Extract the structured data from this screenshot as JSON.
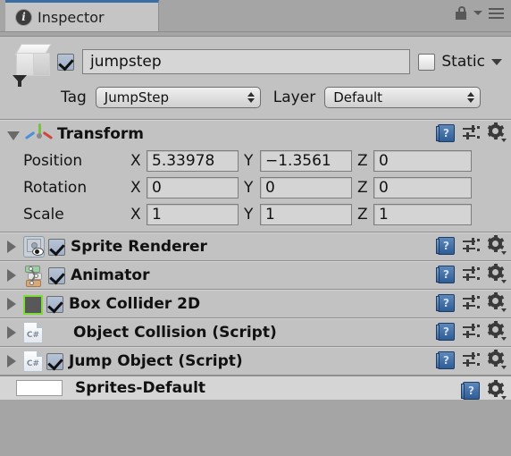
{
  "window": {
    "tab_label": "Inspector",
    "tab_icon": "info-icon",
    "lock_icon": "lock-open-icon",
    "menu_icon": "hamburger-menu-icon"
  },
  "gameobject": {
    "icon": "cube-prefab-icon",
    "enabled": true,
    "name": "jumpstep",
    "static_label": "Static",
    "static_checked": false,
    "tag_label": "Tag",
    "tag_value": "JumpStep",
    "layer_label": "Layer",
    "layer_value": "Default"
  },
  "transform": {
    "title": "Transform",
    "icon": "transform-axis-gizmo-icon",
    "expanded": true,
    "rows": [
      {
        "label": "Position",
        "x": "5.33978",
        "y": "−1.3561",
        "z": "0"
      },
      {
        "label": "Rotation",
        "x": "0",
        "y": "0",
        "z": "0"
      },
      {
        "label": "Scale",
        "x": "1",
        "y": "1",
        "z": "1"
      }
    ],
    "axis_labels": {
      "x": "X",
      "y": "Y",
      "z": "Z"
    }
  },
  "components": [
    {
      "title": "Sprite Renderer",
      "icon": "sprite-renderer-icon",
      "has_checkbox": true,
      "enabled": true,
      "expanded": false
    },
    {
      "title": "Animator",
      "icon": "animator-icon",
      "has_checkbox": true,
      "enabled": true,
      "expanded": false
    },
    {
      "title": "Box Collider 2D",
      "icon": "box-collider-2d-icon",
      "has_checkbox": true,
      "enabled": true,
      "expanded": false
    },
    {
      "title": "Object Collision (Script)",
      "icon": "csharp-script-icon",
      "has_checkbox": false,
      "enabled": false,
      "expanded": false
    },
    {
      "title": "Jump Object (Script)",
      "icon": "csharp-script-icon",
      "has_checkbox": true,
      "enabled": true,
      "expanded": false
    }
  ],
  "material": {
    "label": "Sprites-Default",
    "swatch_color": "#ffffff"
  },
  "header_icons": {
    "help": "help-book-icon",
    "preset": "preset-sliders-icon",
    "settings": "gear-icon"
  },
  "colors": {
    "panel_bg": "#c2c2c2",
    "window_bg": "#a5a5a5",
    "tab_active": "#c5c5c5",
    "tab_accent": "#3a6ea5",
    "field_bg": "#d4d4d4",
    "checkbox_on": "#a9bace",
    "collider_green": "#7ddb3a"
  }
}
